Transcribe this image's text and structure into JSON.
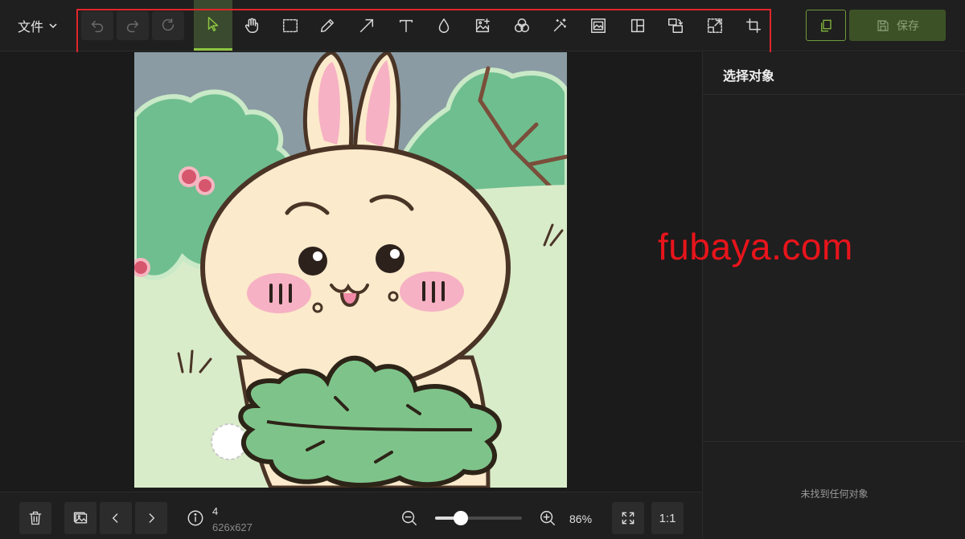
{
  "header": {
    "file_menu_label": "文件",
    "tools": [
      {
        "name": "undo",
        "icon": "undo-icon",
        "state": "disabled"
      },
      {
        "name": "redo",
        "icon": "redo-icon",
        "state": "disabled"
      },
      {
        "name": "reset",
        "icon": "reset-icon",
        "state": "disabled"
      },
      {
        "name": "select",
        "icon": "cursor-icon",
        "state": "active"
      },
      {
        "name": "pan",
        "icon": "hand-icon",
        "state": "normal"
      },
      {
        "name": "marquee",
        "icon": "marquee-icon",
        "state": "normal"
      },
      {
        "name": "pencil",
        "icon": "pencil-icon",
        "state": "normal"
      },
      {
        "name": "arrow",
        "icon": "arrow-icon",
        "state": "normal"
      },
      {
        "name": "text",
        "icon": "text-icon",
        "state": "normal"
      },
      {
        "name": "blur",
        "icon": "drop-icon",
        "state": "normal"
      },
      {
        "name": "add-image",
        "icon": "add-image-icon",
        "state": "normal"
      },
      {
        "name": "filters",
        "icon": "filters-icon",
        "state": "normal"
      },
      {
        "name": "magic",
        "icon": "magic-wand-icon",
        "state": "normal"
      },
      {
        "name": "frame",
        "icon": "frame-icon",
        "state": "normal"
      },
      {
        "name": "layout",
        "icon": "layout-icon",
        "state": "normal"
      },
      {
        "name": "rotate",
        "icon": "rotate-icon",
        "state": "normal"
      },
      {
        "name": "resize",
        "icon": "resize-icon",
        "state": "normal"
      },
      {
        "name": "crop",
        "icon": "crop-icon",
        "state": "normal"
      }
    ],
    "save_label": "保存"
  },
  "panel": {
    "title": "选择对象",
    "empty_text": "未找到任何对象"
  },
  "watermark": "fubaya.com",
  "footer": {
    "image_index": "4",
    "image_size": "626x627",
    "zoom_label": "86%",
    "zoom_fraction": 0.3,
    "one_to_one_label": "1:1"
  },
  "colors": {
    "accent": "#8cc63f",
    "highlight_box": "#e0262b",
    "watermark": "#e8141b",
    "save_button": "#3c5226"
  }
}
